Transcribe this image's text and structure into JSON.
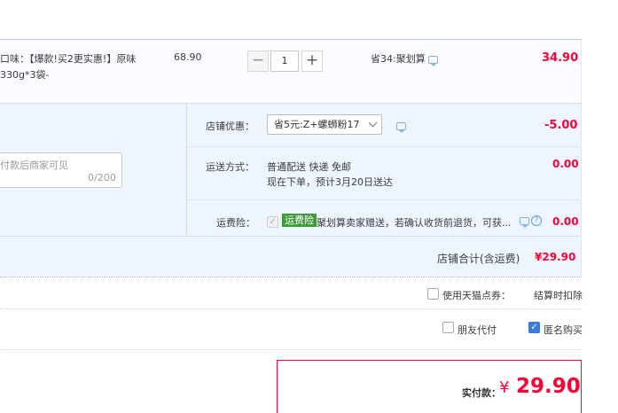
{
  "item": {
    "title_line1": "口味：【爆款!买2更实惠!】原味",
    "title_line2": "330g*3袋-",
    "unit_price": "68.90",
    "qty_minus": "−",
    "quantity": "1",
    "qty_plus": "+",
    "promotion": "省34:聚划算",
    "subtotal": "34.90"
  },
  "memo": {
    "placeholder": "付款后商家可见",
    "count": "0/200"
  },
  "shop_promo": {
    "label": "店铺优惠：",
    "selected": "省5元:Z+螺蛳粉17",
    "amount": "-5.00"
  },
  "shipping": {
    "label": "运送方式：",
    "method": "普通配送 快递 免邮",
    "eta": "现在下单，预计3月20日送达",
    "amount": "0.00"
  },
  "insurance": {
    "label": "运费险：",
    "check_mark": "✓",
    "badge": "运费险",
    "text": "聚划算卖家赠送，若确认收货前退货，可获...",
    "help": "?",
    "amount": "0.00"
  },
  "shop_total": {
    "label": "店铺合计(含运费)",
    "value": "¥29.90"
  },
  "points": {
    "label": "使用天猫点券：",
    "deduct": "结算时扣除"
  },
  "pay_options": {
    "friend_pay": "朋友代付",
    "anonymous": "匿名购买",
    "anonymous_check": "✓"
  },
  "payment": {
    "label": "实付款：",
    "currency": "¥",
    "amount": "29.90"
  },
  "colors": {
    "accent_red": "#ff0036",
    "panel_blue": "#eef5ff",
    "badge_green": "#3d9b3a",
    "checkbox_blue": "#3d7bd8"
  }
}
